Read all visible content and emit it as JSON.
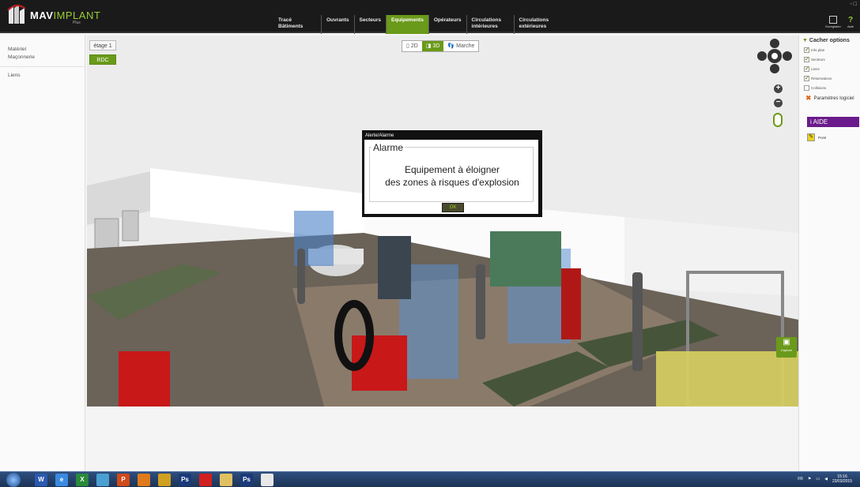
{
  "app": {
    "logo_text_bold": "MAV",
    "logo_text_thin": "IMPLANT",
    "logo_sub": "Plus",
    "window_controls": "- □"
  },
  "nav": [
    {
      "label": "Tracé Bâtiments",
      "active": false
    },
    {
      "label": "Ouvrants",
      "active": false
    },
    {
      "label": "Secteurs",
      "active": false
    },
    {
      "label": "Equipements",
      "active": true
    },
    {
      "label": "Opérateurs",
      "active": false
    },
    {
      "label": "Circulations intérieures",
      "active": false
    },
    {
      "label": "Circulations extérieures",
      "active": false
    }
  ],
  "top_right": {
    "save_label": "Enregistrer",
    "help_label": "Aide",
    "help_glyph": "?"
  },
  "left_panel": {
    "items": [
      "Matériel",
      "Maçonnerie"
    ],
    "links_label": "Liens"
  },
  "viewport": {
    "floor_upper": "étage 1",
    "floor_ground": "RDC",
    "view_modes": [
      {
        "label": "2D",
        "active": false
      },
      {
        "label": "3D",
        "active": true
      },
      {
        "label": "Marche",
        "active": false
      }
    ],
    "capture_label": "Capture",
    "accent_color": "#6a9a1a"
  },
  "dialog": {
    "window_title": "Alerte/Alarme",
    "group_title": "Alarme",
    "message_line1": "Equipement à éloigner",
    "message_line2": "des zones à risques d'explosion",
    "ok_label": "OK"
  },
  "right_panel": {
    "header": "Cacher options",
    "options": [
      {
        "label": "Info plan",
        "checked": true
      },
      {
        "label": "Secteurs",
        "checked": true
      },
      {
        "label": "Liens",
        "checked": true
      },
      {
        "label": "Réservations",
        "checked": true
      },
      {
        "label": "Collisions",
        "checked": false
      }
    ],
    "params_label": "Paramètres logiciel",
    "aide_label": "AIDE",
    "posed_label": "Posé"
  },
  "taskbar": {
    "apps": [
      {
        "label": "W",
        "color": "#2a5ab0"
      },
      {
        "label": "e",
        "color": "#3a8ae0"
      },
      {
        "label": "X",
        "color": "#2a8a3a"
      },
      {
        "label": "",
        "color": "#4aa0d0"
      },
      {
        "label": "P",
        "color": "#d04a1a"
      },
      {
        "label": "",
        "color": "#e07a1a"
      },
      {
        "label": "",
        "color": "#d0a020"
      },
      {
        "label": "Ps",
        "color": "#1a3a7a"
      },
      {
        "label": "",
        "color": "#d02020"
      },
      {
        "label": "",
        "color": "#e0c060"
      },
      {
        "label": "Ps",
        "color": "#1a3a7a"
      },
      {
        "label": "",
        "color": "#e8e8e8"
      }
    ],
    "lang": "FR",
    "time": "15:16",
    "date": "23/03/2015"
  }
}
